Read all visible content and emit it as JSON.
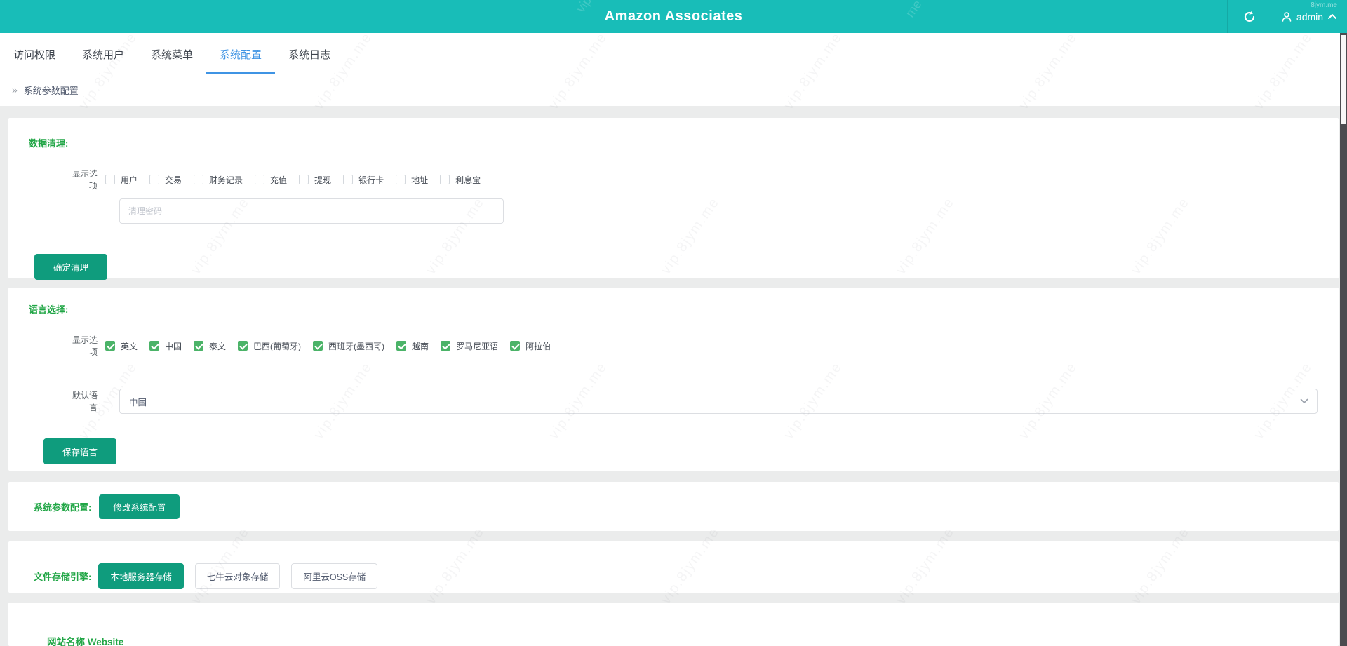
{
  "header": {
    "title": "Amazon Associates",
    "user_label": "admin"
  },
  "watermark": {
    "tile": "vip.8jym.me",
    "corner": "8jym.me"
  },
  "tabs": {
    "items": [
      {
        "label": "访问权限"
      },
      {
        "label": "系统用户"
      },
      {
        "label": "系统菜单"
      },
      {
        "label": "系统配置"
      },
      {
        "label": "系统日志"
      }
    ],
    "active_index": 3
  },
  "breadcrumb": {
    "label": "系统参数配置"
  },
  "sections": {
    "data_clean": {
      "heading": "数据清理:",
      "options_label": "显示选项",
      "options": [
        "用户",
        "交易",
        "财务记录",
        "充值",
        "提现",
        "银行卡",
        "地址",
        "利息宝"
      ],
      "password_placeholder": "清理密码",
      "submit_label": "确定清理"
    },
    "language": {
      "heading": "语言选择:",
      "options_label": "显示选项",
      "options": [
        "英文",
        "中国",
        "泰文",
        "巴西(葡萄牙)",
        "西班牙(墨西哥)",
        "越南",
        "罗马尼亚语",
        "阿拉伯"
      ],
      "default_label": "默认语言",
      "default_value": "中国",
      "submit_label": "保存语言"
    },
    "system_config": {
      "heading": "系统参数配置:",
      "button_label": "修改系统配置"
    },
    "storage": {
      "heading": "文件存储引擎:",
      "buttons": [
        "本地服务器存储",
        "七牛云对象存储",
        "阿里云OSS存储"
      ],
      "active_index": 0
    },
    "website": {
      "heading": "网站名称 Website"
    }
  },
  "colors": {
    "header_teal": "#18bdb8",
    "button_teal": "#0f9c7d",
    "heading_green": "#21a646",
    "checkbox_green": "#4bb368",
    "tab_active_blue": "#3f94e4",
    "page_background": "#ebecec"
  }
}
